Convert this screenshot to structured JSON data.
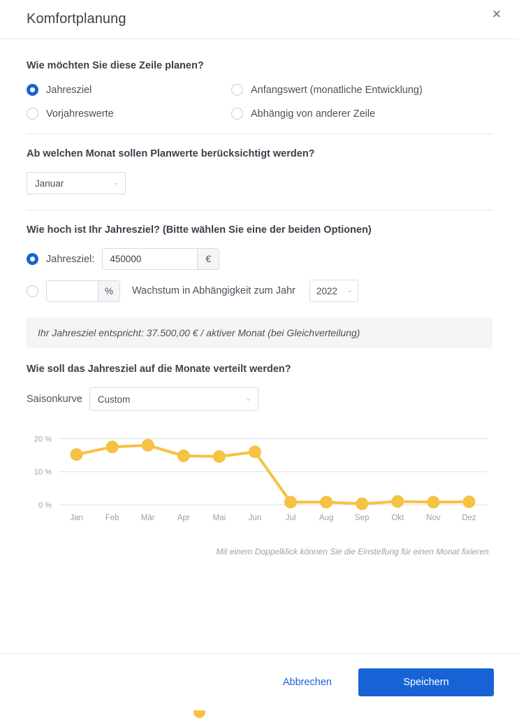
{
  "header": {
    "title": "Komfortplanung",
    "close_icon": "close-icon",
    "close_glyph": "✕"
  },
  "planning_mode": {
    "question": "Wie möchten Sie diese Zeile planen?",
    "options": [
      {
        "label": "Jahresziel",
        "selected": true
      },
      {
        "label": "Anfangswert (monatliche Entwicklung)",
        "selected": false
      },
      {
        "label": "Vorjahreswerte",
        "selected": false
      },
      {
        "label": "Abhängig von anderer Zeile",
        "selected": false
      }
    ]
  },
  "start_month": {
    "question": "Ab welchen Monat sollen Planwerte berücksichtigt werden?",
    "value": "Januar",
    "chevron": "⌄"
  },
  "goal": {
    "question": "Wie hoch ist Ihr Jahresziel? (Bitte wählen Sie eine der beiden Optionen)",
    "absolute": {
      "selected": true,
      "label": "Jahresziel:",
      "value": "450000",
      "suffix": "€"
    },
    "growth": {
      "selected": false,
      "value": "",
      "suffix": "%",
      "text": "Wachstum in Abhängigkeit zum Jahr",
      "year": "2022",
      "chevron": "⌄"
    }
  },
  "info_banner": {
    "text": "Ihr Jahresziel entspricht: 37.500,00 € / aktiver Monat (bei Gleichverteilung)"
  },
  "distribution": {
    "question": "Wie soll das Jahresziel auf die Monate verteilt werden?",
    "season_label": "Saisonkurve",
    "season_value": "Custom",
    "chevron": "⌄",
    "note": "Mit einem Doppelklick können Sie die Einstellung für einen Monat fixieren."
  },
  "footer": {
    "cancel_label": "Abbrechen",
    "save_label": "Speichern"
  },
  "colors": {
    "accent_blue": "#1763d6",
    "curve_yellow": "#f5c242",
    "banner_bg": "#f5f5f6",
    "text": "#4a515c"
  },
  "chart_data": {
    "type": "line",
    "title": "",
    "xlabel": "",
    "ylabel": "",
    "categories": [
      "Jan",
      "Feb",
      "Mär",
      "Apr",
      "Mai",
      "Jun",
      "Jul",
      "Aug",
      "Sep",
      "Okt",
      "Nov",
      "Dez"
    ],
    "values": [
      15.2,
      17.5,
      18.0,
      14.8,
      14.6,
      16.0,
      0.8,
      0.8,
      0.3,
      1.0,
      0.8,
      0.9
    ],
    "ylim": [
      0,
      22
    ],
    "yticks": [
      0,
      10,
      20
    ],
    "ytick_labels": [
      "0 %",
      "10 %",
      "20 %"
    ],
    "grid": true,
    "legend": false,
    "series_color": "#f5c242",
    "marker": "circle"
  }
}
